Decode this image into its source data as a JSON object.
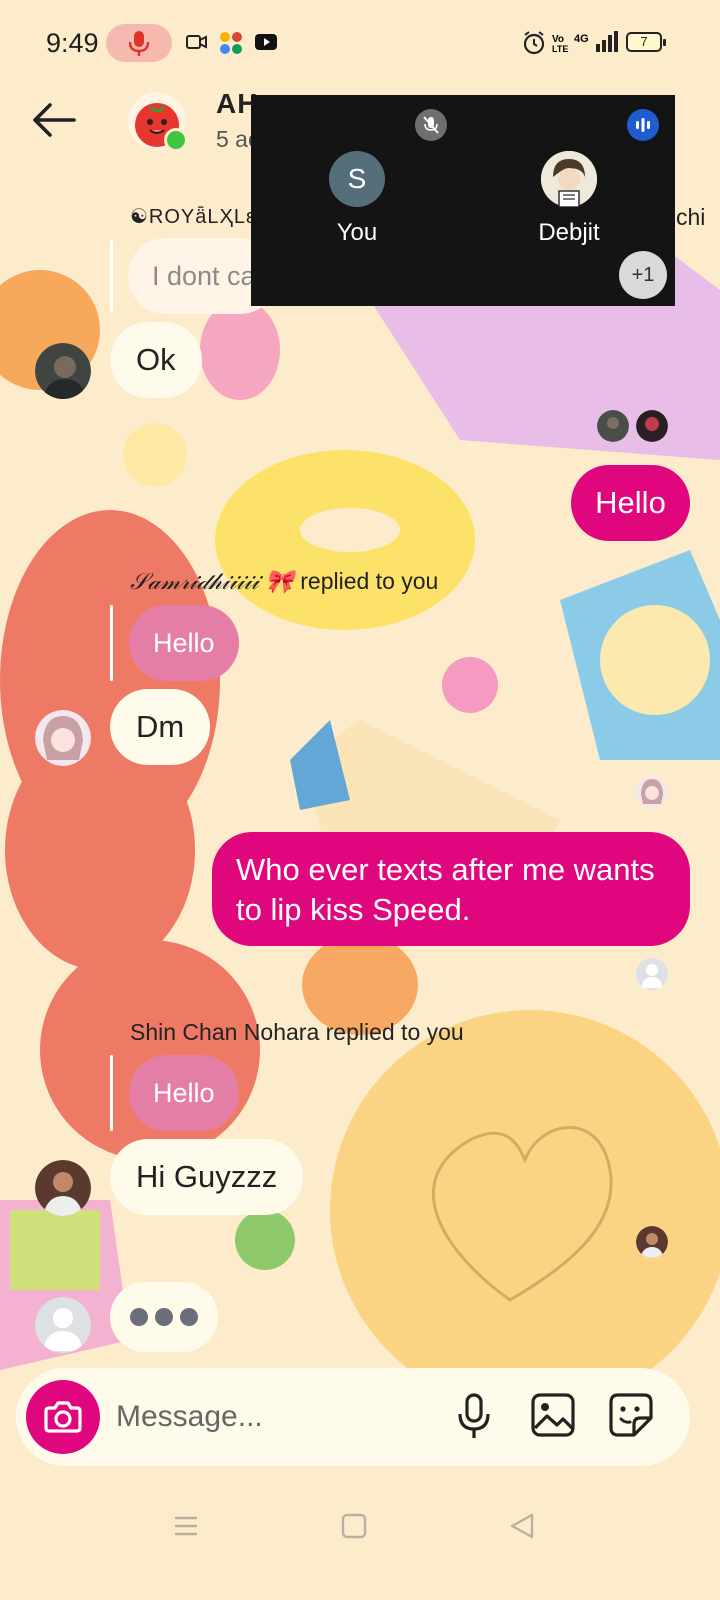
{
  "status_bar": {
    "time": "9:49",
    "battery": "7",
    "network": "4G"
  },
  "header": {
    "group_title": "AH",
    "group_subtitle": "5 ac"
  },
  "call_overlay": {
    "participants": [
      {
        "initial": "S",
        "name": "You"
      },
      {
        "name": "Debjit"
      }
    ],
    "more_count": "+1"
  },
  "messages": {
    "cropped_sender": "☯ROYǟLҲLɛ",
    "cropped_sender_tail": "chi",
    "faded_reply_text": "I dont ca",
    "ok": "Ok",
    "hello_out": "Hello",
    "reply1_sender": "𝒮𝒶𝓂𝓇𝒾𝒹𝒽𝒾𝒾𝒾𝒾𝒾 🎀",
    "reply1_label": "replied to you",
    "reply1_quote": "Hello",
    "dm": "Dm",
    "long_out_line1": "Who ever texts after me wants",
    "long_out_line2": "to lip kiss Speed.",
    "reply2_label": "Shin Chan Nohara replied to you",
    "reply2_quote": "Hello",
    "hi_guyzzz": "Hi Guyzzz"
  },
  "composer": {
    "placeholder": "Message..."
  },
  "icons": {
    "back": "arrow-left-icon",
    "camera": "camera-icon",
    "mic": "microphone-icon",
    "gallery": "image-icon",
    "sticker": "sticker-icon"
  },
  "colors": {
    "accent": "#e0067d",
    "background": "#fdeccb",
    "incoming_bubble": "#fffbea",
    "reply_quote": "#e57ea6",
    "call_overlay": "#141414"
  }
}
